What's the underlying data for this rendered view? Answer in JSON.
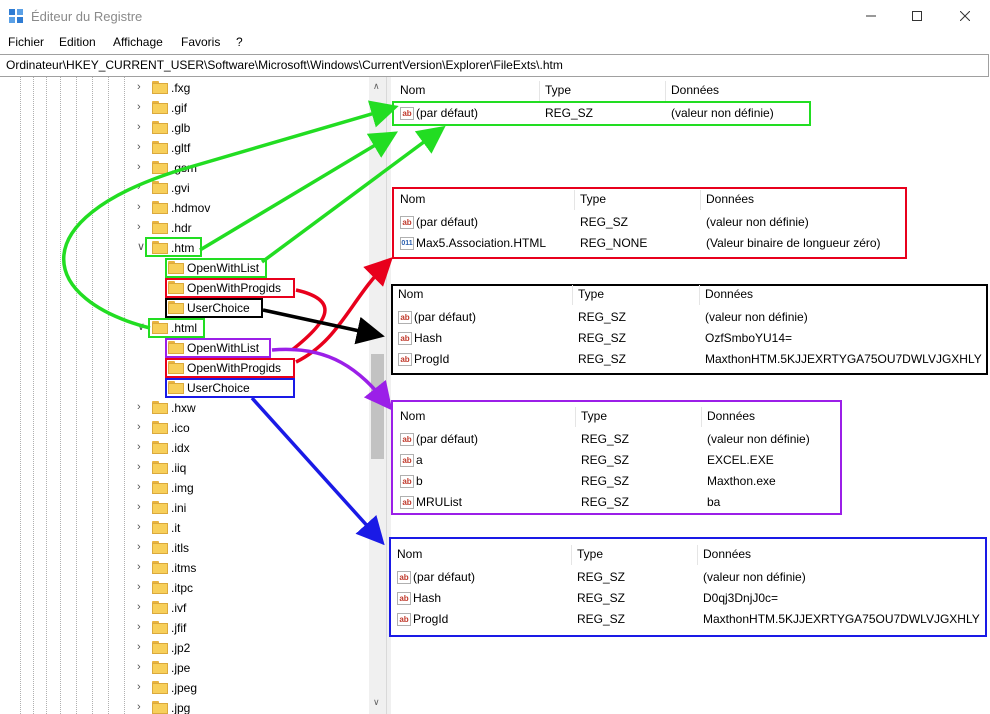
{
  "window": {
    "title": "Éditeur du Registre",
    "accent_color": "#0078d7"
  },
  "menu": [
    "Fichier",
    "Edition",
    "Affichage",
    "Favoris",
    "?"
  ],
  "address": "Ordinateur\\HKEY_CURRENT_USER\\Software\\Microsoft\\Windows\\CurrentVersion\\Explorer\\FileExts\\.htm",
  "tree": {
    "items": [
      {
        "label": ".fxg",
        "expanded": false
      },
      {
        "label": ".gif",
        "expanded": false
      },
      {
        "label": ".glb",
        "expanded": false
      },
      {
        "label": ".gltf",
        "expanded": false
      },
      {
        "label": ".gsm",
        "expanded": false
      },
      {
        "label": ".gvi",
        "expanded": false
      },
      {
        "label": ".hdmov",
        "expanded": false
      },
      {
        "label": ".hdr",
        "expanded": false
      },
      {
        "label": ".htm",
        "expanded": true
      },
      {
        "label": "OpenWithList",
        "child": true
      },
      {
        "label": "OpenWithProgids",
        "child": true
      },
      {
        "label": "UserChoice",
        "child": true
      },
      {
        "label": ".html",
        "expanded": true
      },
      {
        "label": "OpenWithList",
        "child": true
      },
      {
        "label": "OpenWithProgids",
        "child": true
      },
      {
        "label": "UserChoice",
        "child": true
      },
      {
        "label": ".hxw",
        "expanded": false
      },
      {
        "label": ".ico",
        "expanded": false
      },
      {
        "label": ".idx",
        "expanded": false
      },
      {
        "label": ".iiq",
        "expanded": false
      },
      {
        "label": ".img",
        "expanded": false
      },
      {
        "label": ".ini",
        "expanded": false
      },
      {
        "label": ".it",
        "expanded": false
      },
      {
        "label": ".itls",
        "expanded": false
      },
      {
        "label": ".itms",
        "expanded": false
      },
      {
        "label": ".itpc",
        "expanded": false
      },
      {
        "label": ".ivf",
        "expanded": false
      },
      {
        "label": ".jfif",
        "expanded": false
      },
      {
        "label": ".jp2",
        "expanded": false
      },
      {
        "label": ".jpe",
        "expanded": false
      },
      {
        "label": ".jpeg",
        "expanded": false
      },
      {
        "label": ".jpg",
        "expanded": false
      }
    ]
  },
  "values_headers": {
    "name": "Nom",
    "type": "Type",
    "data": "Données"
  },
  "value_tables": [
    {
      "color": "#22dd22",
      "rows": [
        {
          "name": "(par défaut)",
          "type": "REG_SZ",
          "data": "(valeur non définie)",
          "icon": "string-value-icon"
        }
      ]
    },
    {
      "color": "#e8001c",
      "rows": [
        {
          "name": "(par défaut)",
          "type": "REG_SZ",
          "data": "(valeur non définie)",
          "icon": "string-value-icon"
        },
        {
          "name": "Max5.Association.HTML",
          "type": "REG_NONE",
          "data": "(Valeur binaire de longueur zéro)",
          "icon": "binary-value-icon"
        }
      ]
    },
    {
      "color": "#000000",
      "rows": [
        {
          "name": "(par défaut)",
          "type": "REG_SZ",
          "data": "(valeur non définie)",
          "icon": "string-value-icon"
        },
        {
          "name": "Hash",
          "type": "REG_SZ",
          "data": "OzfSmboYU14=",
          "icon": "string-value-icon"
        },
        {
          "name": "ProgId",
          "type": "REG_SZ",
          "data": "MaxthonHTM.5KJJEXRTYGA75OU7DWLVJGXHLY",
          "icon": "string-value-icon"
        }
      ]
    },
    {
      "color": "#9b1fe8",
      "rows": [
        {
          "name": "(par défaut)",
          "type": "REG_SZ",
          "data": "(valeur non définie)",
          "icon": "string-value-icon"
        },
        {
          "name": "a",
          "type": "REG_SZ",
          "data": "EXCEL.EXE",
          "icon": "string-value-icon"
        },
        {
          "name": "b",
          "type": "REG_SZ",
          "data": "Maxthon.exe",
          "icon": "string-value-icon"
        },
        {
          "name": "MRUList",
          "type": "REG_SZ",
          "data": "ba",
          "icon": "string-value-icon"
        }
      ]
    },
    {
      "color": "#1a1ae6",
      "rows": [
        {
          "name": "(par défaut)",
          "type": "REG_SZ",
          "data": "(valeur non définie)",
          "icon": "string-value-icon"
        },
        {
          "name": "Hash",
          "type": "REG_SZ",
          "data": "D0qj3DnjJ0c=",
          "icon": "string-value-icon"
        },
        {
          "name": "ProgId",
          "type": "REG_SZ",
          "data": "MaxthonHTM.5KJJEXRTYGA75OU7DWLVJGXHLY",
          "icon": "string-value-icon"
        }
      ]
    }
  ],
  "annotation_colors": {
    "green": "#22dd22",
    "red": "#e8001c",
    "black": "#000000",
    "purple": "#9b1fe8",
    "blue": "#1a1ae6"
  }
}
